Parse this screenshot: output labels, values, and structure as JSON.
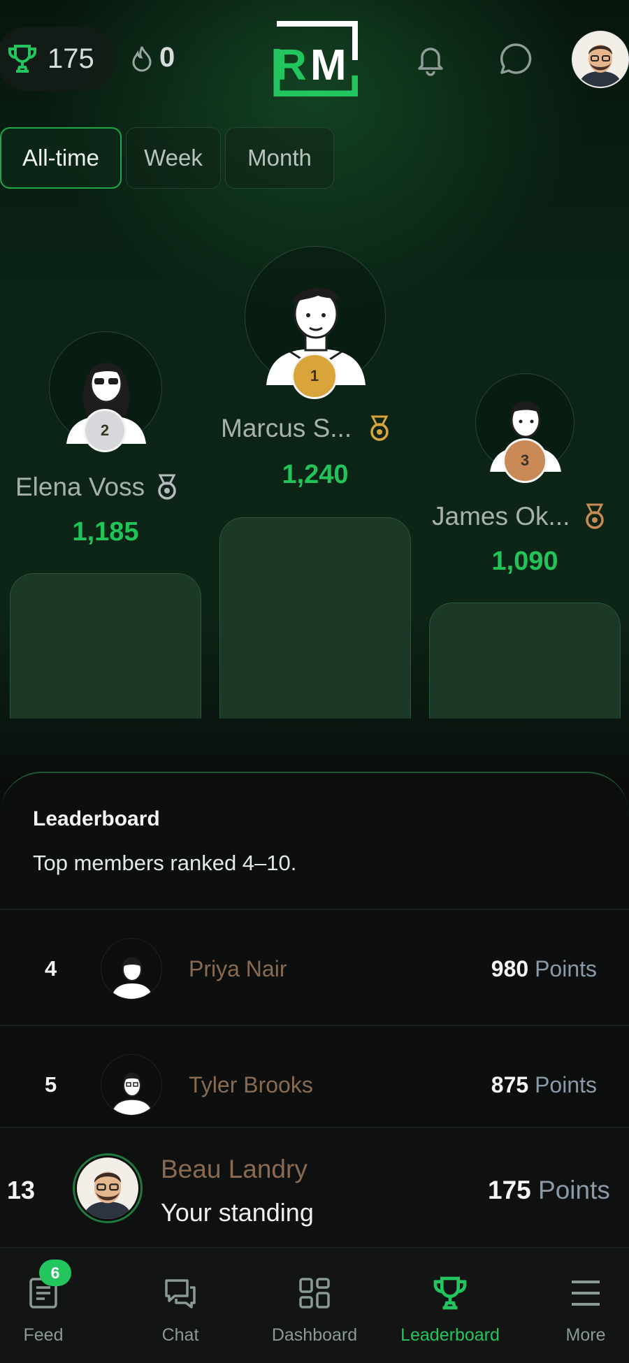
{
  "header": {
    "points": "175",
    "streak": "0",
    "logo_text": "RM"
  },
  "tabs": [
    {
      "label": "All-time",
      "active": true
    },
    {
      "label": "Week",
      "active": false
    },
    {
      "label": "Month",
      "active": false
    }
  ],
  "podium": {
    "first": {
      "rank": "1",
      "name": "Marcus S...",
      "score": "1,240",
      "medal_color": "#d9a43a"
    },
    "second": {
      "rank": "2",
      "name": "Elena Voss",
      "score": "1,185",
      "medal_color": "#d6d8dc"
    },
    "third": {
      "rank": "3",
      "name": "James Ok...",
      "score": "1,090",
      "medal_color": "#c98a57"
    }
  },
  "leaderboard": {
    "title": "Leaderboard",
    "subtitle": "Top members ranked 4–10.",
    "rows": [
      {
        "rank": "4",
        "name": "Priya Nair",
        "points": "980",
        "unit": "Points"
      },
      {
        "rank": "5",
        "name": "Tyler Brooks",
        "points": "875",
        "unit": "Points"
      }
    ]
  },
  "me": {
    "rank": "13",
    "name": "Beau Landry",
    "caption": "Your standing",
    "points": "175",
    "unit": "Points"
  },
  "nav": {
    "items": [
      {
        "label": "Feed",
        "icon": "feed-icon",
        "badge": "6"
      },
      {
        "label": "Chat",
        "icon": "chat-icon"
      },
      {
        "label": "Dashboard",
        "icon": "dashboard-icon"
      },
      {
        "label": "Leaderboard",
        "icon": "trophy-icon",
        "active": true
      },
      {
        "label": "More",
        "icon": "menu-icon"
      }
    ]
  },
  "colors": {
    "accent": "#22c55e",
    "gold": "#d9a43a",
    "silver": "#d6d8dc",
    "bronze": "#c98a57"
  }
}
